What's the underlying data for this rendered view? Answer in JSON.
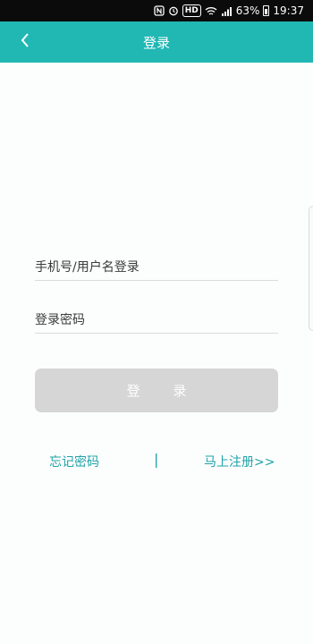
{
  "status_bar": {
    "hd_label": "HD",
    "battery": "63%",
    "time": "19:37"
  },
  "header": {
    "title": "登录"
  },
  "form": {
    "username_placeholder": "手机号/用户名登录",
    "password_placeholder": "登录密码",
    "login_label": "登 录"
  },
  "links": {
    "forgot_password": "忘记密码",
    "divider": "|",
    "register": "马上注册>>"
  },
  "colors": {
    "accent": "#21b8b4",
    "link": "#1fa3a8",
    "button_disabled": "#d6d6d6"
  }
}
